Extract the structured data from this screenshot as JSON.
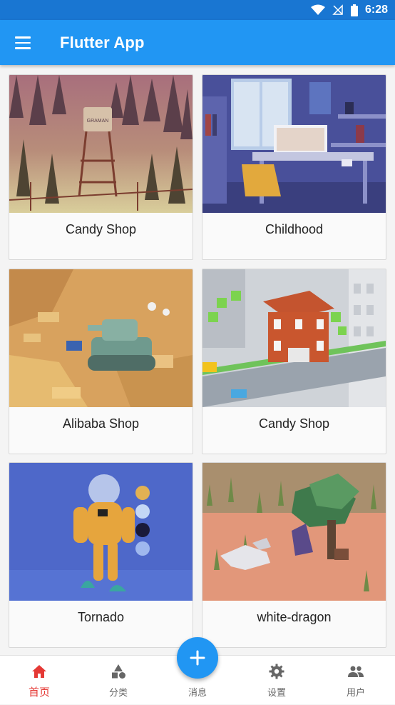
{
  "status_bar": {
    "time": "6:28",
    "icons": [
      "wifi-icon",
      "no-signal-icon",
      "battery-icon"
    ],
    "color": "#1976d2"
  },
  "app_bar": {
    "title": "Flutter App",
    "menu_icon": "menu-icon",
    "color": "#2196f3"
  },
  "cards": [
    {
      "caption": "Candy Shop",
      "image": "water-tower-forest"
    },
    {
      "caption": "Childhood",
      "image": "room-desk"
    },
    {
      "caption": "Alibaba Shop",
      "image": "desert-tank"
    },
    {
      "caption": "Candy Shop",
      "image": "red-house-street"
    },
    {
      "caption": "Tornado",
      "image": "astronaut-spheres"
    },
    {
      "caption": "white-dragon",
      "image": "dragon-tree"
    }
  ],
  "fab": {
    "icon": "plus-icon",
    "color": "#2196f3"
  },
  "bottom_nav": {
    "items": [
      {
        "label": "首页",
        "icon": "home-icon",
        "active": true
      },
      {
        "label": "分类",
        "icon": "category-icon",
        "active": false
      },
      {
        "label": "消息",
        "icon": "message-icon",
        "active": false
      },
      {
        "label": "设置",
        "icon": "settings-icon",
        "active": false
      },
      {
        "label": "用户",
        "icon": "people-icon",
        "active": false
      }
    ],
    "active_color": "#e53935",
    "inactive_color": "#666666"
  }
}
